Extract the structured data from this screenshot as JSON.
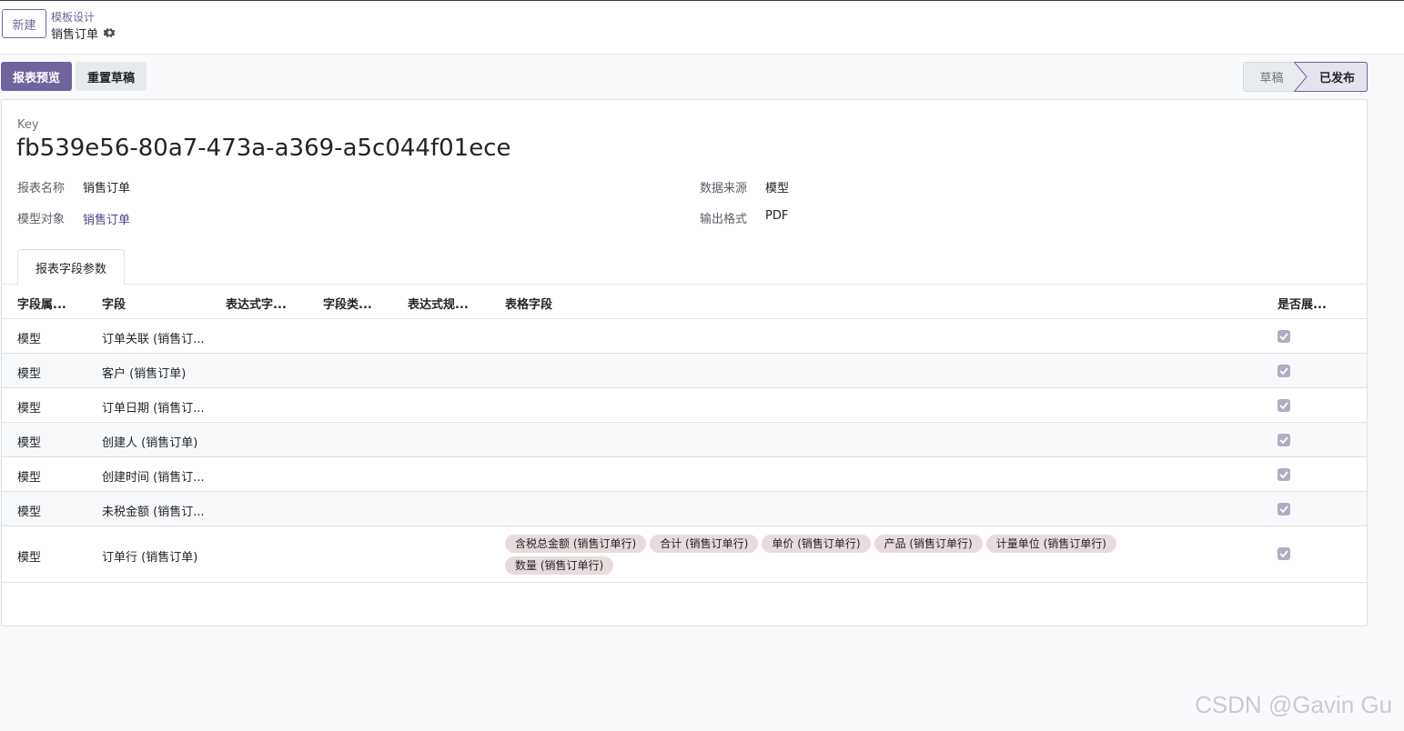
{
  "topbar": {
    "new_label": "新建",
    "breadcrumb_parent": "模板设计",
    "breadcrumb_current": "销售订单"
  },
  "actions": {
    "preview_label": "报表预览",
    "reset_label": "重置草稿"
  },
  "status": {
    "draft": "草稿",
    "published": "已发布",
    "active": "published"
  },
  "form": {
    "key_label": "Key",
    "key_value": "fb539e56-80a7-473a-a369-a5c044f01ece",
    "report_name_label": "报表名称",
    "report_name_value": "销售订单",
    "model_label": "模型对象",
    "model_value": "销售订单",
    "datasource_label": "数据来源",
    "datasource_value": "模型",
    "output_label": "输出格式",
    "output_value": "PDF"
  },
  "tab": {
    "label": "报表字段参数"
  },
  "table": {
    "headers": [
      "字段属...",
      "字段",
      "表达式字...",
      "字段类...",
      "表达式规...",
      "表格字段",
      "是否展..."
    ],
    "rows": [
      {
        "type": "模型",
        "field": "订单关联 (销售订...",
        "tags": [],
        "shown": true
      },
      {
        "type": "模型",
        "field": "客户 (销售订单)",
        "tags": [],
        "shown": true
      },
      {
        "type": "模型",
        "field": "订单日期 (销售订...",
        "tags": [],
        "shown": true
      },
      {
        "type": "模型",
        "field": "创建人 (销售订单)",
        "tags": [],
        "shown": true
      },
      {
        "type": "模型",
        "field": "创建时间 (销售订...",
        "tags": [],
        "shown": true
      },
      {
        "type": "模型",
        "field": "未税金额 (销售订...",
        "tags": [],
        "shown": true
      },
      {
        "type": "模型",
        "field": "订单行 (销售订单)",
        "tags": [
          "含税总金额 (销售订单行)",
          "合计 (销售订单行)",
          "单价 (销售订单行)",
          "产品 (销售订单行)",
          "计量单位 (销售订单行)",
          "数量 (销售订单行)"
        ],
        "shown": true
      }
    ]
  },
  "watermark": "CSDN @Gavin Gu",
  "colors": {
    "primary": "#71639e",
    "tag_bg": "#e8dbdc",
    "checkbox": "#b0adc1"
  }
}
